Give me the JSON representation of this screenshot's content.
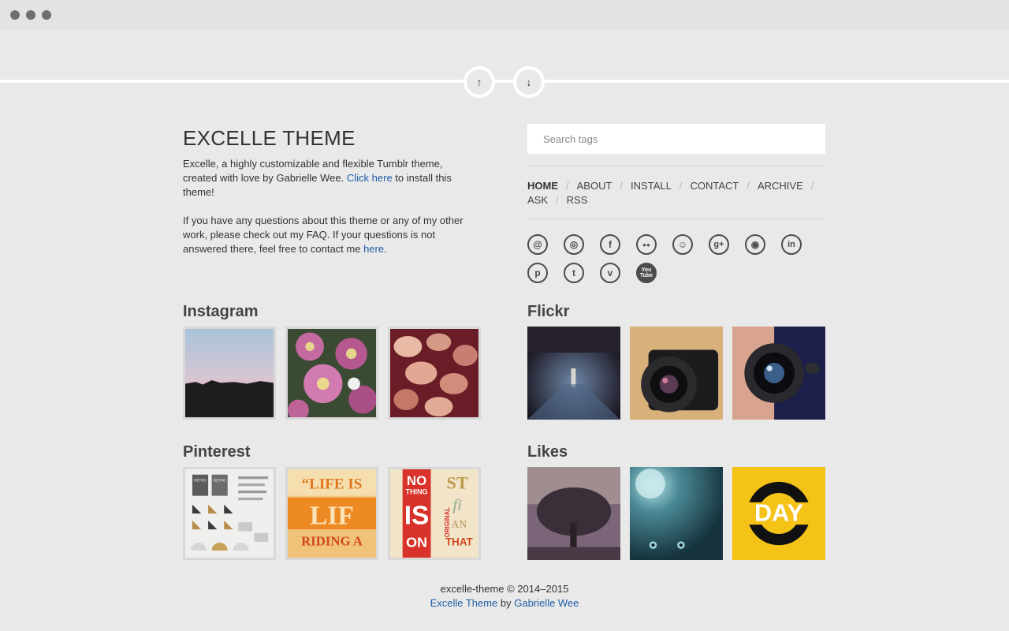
{
  "window": {
    "controls": [
      "close",
      "minimize",
      "zoom"
    ]
  },
  "pager": {
    "up_icon": "↑",
    "down_icon": "↓"
  },
  "blog": {
    "title": "EXCELLE THEME",
    "para1_text": "Excelle, a highly customizable and flexible Tumblr theme, created with love by Gabrielle Wee. ",
    "para1_link": "Click here",
    "para1_after": " to install this theme!",
    "para2_text": "If you have any questions about this theme or any of my other work, please check out my FAQ. If your questions is not answered there, feel free to contact me ",
    "para2_link": "here",
    "para2_after": "."
  },
  "search": {
    "placeholder": "Search tags",
    "value": ""
  },
  "menu": {
    "items": [
      {
        "label": "Home",
        "active": true
      },
      {
        "label": "About"
      },
      {
        "label": "Install"
      },
      {
        "label": "Contact"
      },
      {
        "label": "Archive"
      },
      {
        "label": "Ask"
      },
      {
        "label": "RSS"
      }
    ],
    "separator": "/"
  },
  "social": {
    "icons": [
      {
        "name": "email-icon",
        "glyph": "@"
      },
      {
        "name": "dribbble-icon",
        "glyph": "◎"
      },
      {
        "name": "facebook-icon",
        "glyph": "f"
      },
      {
        "name": "flickr-icon",
        "glyph": "●●"
      },
      {
        "name": "github-icon",
        "glyph": "☺"
      },
      {
        "name": "google-plus-icon",
        "glyph": "g+"
      },
      {
        "name": "instagram-icon",
        "glyph": "◉"
      },
      {
        "name": "linkedin-icon",
        "glyph": "in"
      },
      {
        "name": "pinterest-icon",
        "glyph": "p"
      },
      {
        "name": "twitter-icon",
        "glyph": "t"
      },
      {
        "name": "vimeo-icon",
        "glyph": "v"
      },
      {
        "name": "youtube-icon",
        "glyph": "You Tube"
      }
    ]
  },
  "sections": {
    "instagram": {
      "title": "Instagram"
    },
    "flickr": {
      "title": "Flickr"
    },
    "pinterest": {
      "title": "Pinterest"
    },
    "likes": {
      "title": "Likes"
    }
  },
  "thumb_text": {
    "pin2_a": "“LIFE IS",
    "pin2_b": "LIF",
    "pin2_c": "RIDING A",
    "pin3_a": "NO",
    "pin3_b": "THING",
    "pin3_c": "IS",
    "pin3_d": "ON",
    "pin3_e": "ST",
    "pin3_f": "fi",
    "pin3_g": "AN",
    "pin3_h": "THAT",
    "pin3_i": "ORIGINAL",
    "pin1_a": "RETRO",
    "pin1_b": "RETRO",
    "like3": "DAY"
  },
  "footer": {
    "line1": "excelle-theme © 2014–2015",
    "theme_link": "Excelle Theme",
    "by": " by ",
    "author_link": "Gabrielle Wee"
  },
  "colors": {
    "background": "#e9e9e9",
    "link": "#1f5ea8",
    "text": "#333333"
  }
}
